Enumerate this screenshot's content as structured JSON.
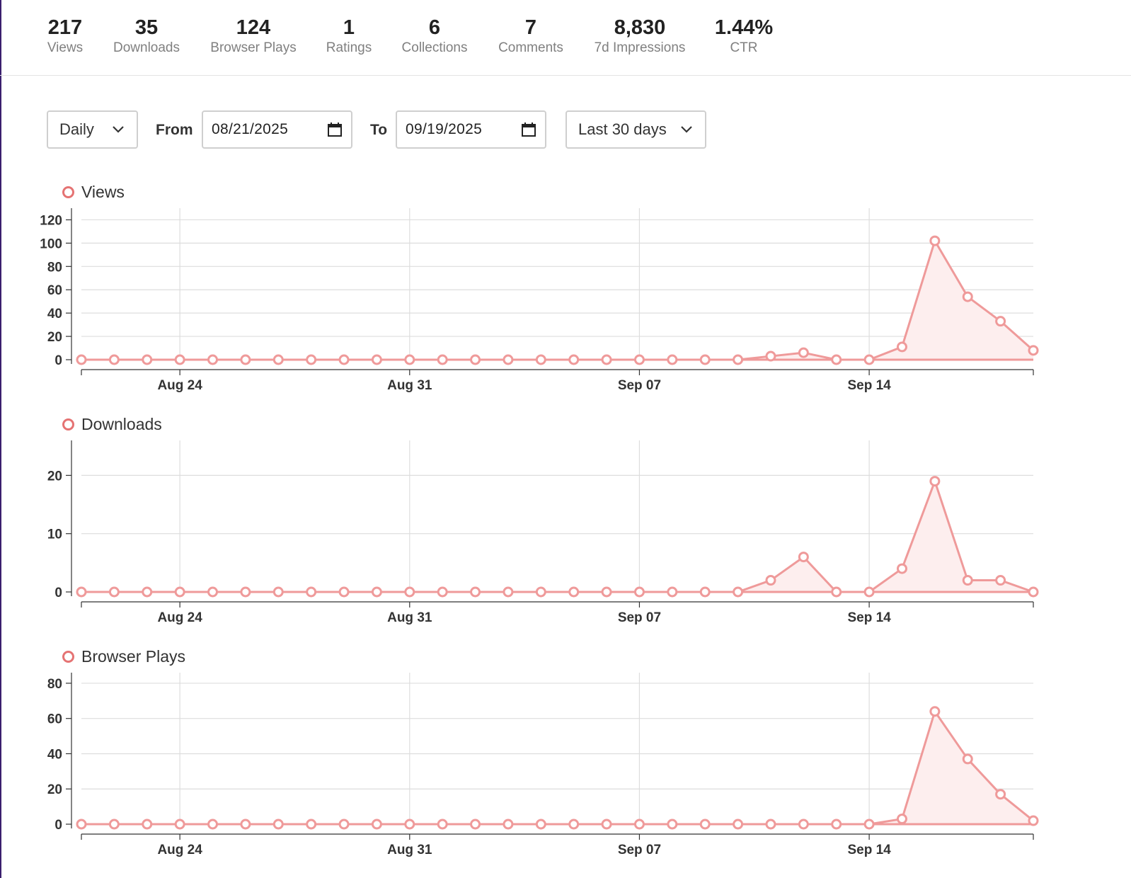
{
  "stats": [
    {
      "value": "217",
      "label": "Views"
    },
    {
      "value": "35",
      "label": "Downloads"
    },
    {
      "value": "124",
      "label": "Browser Plays"
    },
    {
      "value": "1",
      "label": "Ratings"
    },
    {
      "value": "6",
      "label": "Collections"
    },
    {
      "value": "7",
      "label": "Comments"
    },
    {
      "value": "8,830",
      "label": "7d Impressions"
    },
    {
      "value": "1.44%",
      "label": "CTR"
    }
  ],
  "controls": {
    "interval": "Daily",
    "from_label": "From",
    "from_date": "08/21/2025",
    "to_label": "To",
    "to_date": "09/19/2025",
    "range": "Last 30 days"
  },
  "colors": {
    "series": "#ef9a9a",
    "series_fill": "#fdeeee",
    "grid": "#dddddd",
    "axis": "#333333"
  },
  "chart_data": [
    {
      "type": "area",
      "legend": "Views",
      "x": [
        "2025-08-21",
        "2025-08-22",
        "2025-08-23",
        "2025-08-24",
        "2025-08-25",
        "2025-08-26",
        "2025-08-27",
        "2025-08-28",
        "2025-08-29",
        "2025-08-30",
        "2025-08-31",
        "2025-09-01",
        "2025-09-02",
        "2025-09-03",
        "2025-09-04",
        "2025-09-05",
        "2025-09-06",
        "2025-09-07",
        "2025-09-08",
        "2025-09-09",
        "2025-09-10",
        "2025-09-11",
        "2025-09-12",
        "2025-09-13",
        "2025-09-14",
        "2025-09-15",
        "2025-09-16",
        "2025-09-17",
        "2025-09-18",
        "2025-09-19"
      ],
      "values": [
        0,
        0,
        0,
        0,
        0,
        0,
        0,
        0,
        0,
        0,
        0,
        0,
        0,
        0,
        0,
        0,
        0,
        0,
        0,
        0,
        0,
        3,
        6,
        0,
        0,
        11,
        102,
        54,
        33,
        8
      ],
      "ylim": [
        0,
        130
      ],
      "yticks": [
        0,
        20,
        40,
        60,
        80,
        100,
        120
      ],
      "xtick_labels": [
        {
          "date": "2025-08-24",
          "label": "Aug 24"
        },
        {
          "date": "2025-08-31",
          "label": "Aug 31"
        },
        {
          "date": "2025-09-07",
          "label": "Sep 07"
        },
        {
          "date": "2025-09-14",
          "label": "Sep 14"
        }
      ],
      "grid": true
    },
    {
      "type": "area",
      "legend": "Downloads",
      "x": [
        "2025-08-21",
        "2025-08-22",
        "2025-08-23",
        "2025-08-24",
        "2025-08-25",
        "2025-08-26",
        "2025-08-27",
        "2025-08-28",
        "2025-08-29",
        "2025-08-30",
        "2025-08-31",
        "2025-09-01",
        "2025-09-02",
        "2025-09-03",
        "2025-09-04",
        "2025-09-05",
        "2025-09-06",
        "2025-09-07",
        "2025-09-08",
        "2025-09-09",
        "2025-09-10",
        "2025-09-11",
        "2025-09-12",
        "2025-09-13",
        "2025-09-14",
        "2025-09-15",
        "2025-09-16",
        "2025-09-17",
        "2025-09-18",
        "2025-09-19"
      ],
      "values": [
        0,
        0,
        0,
        0,
        0,
        0,
        0,
        0,
        0,
        0,
        0,
        0,
        0,
        0,
        0,
        0,
        0,
        0,
        0,
        0,
        0,
        2,
        6,
        0,
        0,
        4,
        19,
        2,
        2,
        0
      ],
      "ylim": [
        0,
        26
      ],
      "yticks": [
        0,
        10,
        20
      ],
      "xtick_labels": [
        {
          "date": "2025-08-24",
          "label": "Aug 24"
        },
        {
          "date": "2025-08-31",
          "label": "Aug 31"
        },
        {
          "date": "2025-09-07",
          "label": "Sep 07"
        },
        {
          "date": "2025-09-14",
          "label": "Sep 14"
        }
      ],
      "grid": true
    },
    {
      "type": "area",
      "legend": "Browser Plays",
      "x": [
        "2025-08-21",
        "2025-08-22",
        "2025-08-23",
        "2025-08-24",
        "2025-08-25",
        "2025-08-26",
        "2025-08-27",
        "2025-08-28",
        "2025-08-29",
        "2025-08-30",
        "2025-08-31",
        "2025-09-01",
        "2025-09-02",
        "2025-09-03",
        "2025-09-04",
        "2025-09-05",
        "2025-09-06",
        "2025-09-07",
        "2025-09-08",
        "2025-09-09",
        "2025-09-10",
        "2025-09-11",
        "2025-09-12",
        "2025-09-13",
        "2025-09-14",
        "2025-09-15",
        "2025-09-16",
        "2025-09-17",
        "2025-09-18",
        "2025-09-19"
      ],
      "values": [
        0,
        0,
        0,
        0,
        0,
        0,
        0,
        0,
        0,
        0,
        0,
        0,
        0,
        0,
        0,
        0,
        0,
        0,
        0,
        0,
        0,
        0,
        0,
        0,
        0,
        3,
        64,
        37,
        17,
        2
      ],
      "ylim": [
        0,
        86
      ],
      "yticks": [
        0,
        20,
        40,
        60,
        80
      ],
      "xtick_labels": [
        {
          "date": "2025-08-24",
          "label": "Aug 24"
        },
        {
          "date": "2025-08-31",
          "label": "Aug 31"
        },
        {
          "date": "2025-09-07",
          "label": "Sep 07"
        },
        {
          "date": "2025-09-14",
          "label": "Sep 14"
        }
      ],
      "grid": true
    }
  ]
}
